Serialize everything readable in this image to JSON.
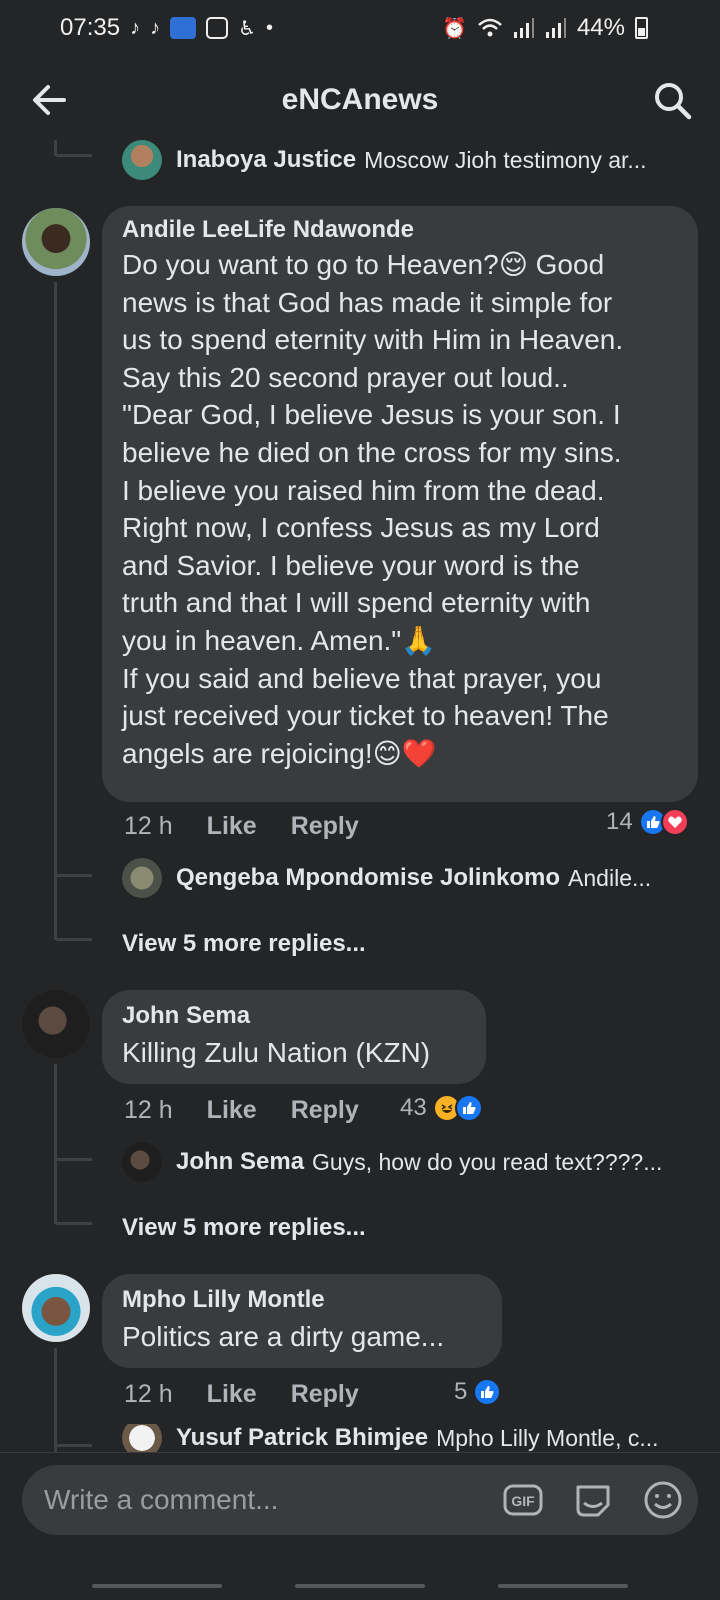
{
  "status_bar": {
    "time": "07:35",
    "battery": "44%",
    "icons": [
      "tiktok-icon",
      "tiktok-icon",
      "movie-app-icon",
      "gallery-icon",
      "accessibility-icon",
      "dot-icon",
      "alarm-icon",
      "wifi-icon",
      "signal-icon",
      "signal-icon",
      "battery-icon"
    ]
  },
  "header": {
    "title": "eNCAnews",
    "back_icon": "arrow-left-icon",
    "search_icon": "search-icon"
  },
  "top_reply": {
    "name": "Inaboya Justice",
    "text": "Moscow Jioh testimony ar..."
  },
  "comments": [
    {
      "author": "Andile LeeLife Ndawonde",
      "lines": [
        "Do you want to go to Heaven?😌 Good",
        "news is that God has made it simple for",
        "us to spend eternity with Him in Heaven.",
        "Say this 20 second prayer out loud..",
        "\"Dear God, I believe Jesus is your son. I",
        "believe he died on the cross for my sins.",
        "I believe you raised him from the dead.",
        "Right now, I confess Jesus as my Lord",
        "and Savior. I believe your word is the",
        "truth and that I will spend eternity with",
        "you in heaven. Amen.\"🙏",
        "If you said and believe that prayer, you",
        "just received your ticket to heaven! The",
        "angels are rejoicing!😊❤️"
      ],
      "time": "12 h",
      "like": "Like",
      "reply": "Reply",
      "reaction_count": "14",
      "reactions": [
        "like",
        "love"
      ],
      "reply_preview": {
        "name": "Qengeba Mpondomise Jolinkomo",
        "text": "Andile..."
      },
      "view_more": "View 5 more replies..."
    },
    {
      "author": "John Sema",
      "text": "Killing Zulu Nation (KZN)",
      "time": "12 h",
      "like": "Like",
      "reply": "Reply",
      "reaction_count": "43",
      "reactions": [
        "haha",
        "like"
      ],
      "reply_preview": {
        "name": "John Sema",
        "text": "Guys, how do you read text????..."
      },
      "view_more": "View 5 more replies..."
    },
    {
      "author": "Mpho Lilly Montle",
      "text": "Politics are a dirty game...",
      "time": "12 h",
      "like": "Like",
      "reply": "Reply",
      "reaction_count": "5",
      "reactions": [
        "like"
      ],
      "reply_preview": {
        "name": "Yusuf Patrick Bhimjee",
        "text": "Mpho Lilly Montle, c..."
      }
    }
  ],
  "composer": {
    "placeholder": "Write a comment...",
    "icons": [
      "gif-icon",
      "sticker-icon",
      "emoji-icon"
    ]
  }
}
